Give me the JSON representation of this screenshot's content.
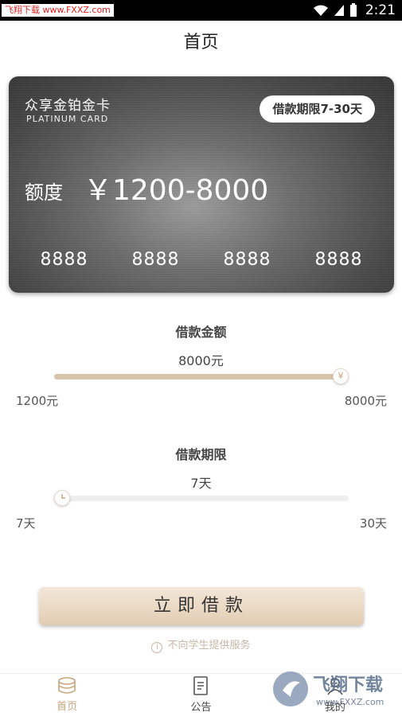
{
  "status_bar": {
    "watermark": "飞翔下载 www.FXXZ.com",
    "time": "2:21"
  },
  "header": {
    "title": "首页"
  },
  "card": {
    "name": "众享金铂金卡",
    "sub_name": "PLATINUM CARD",
    "term_badge": "借款期限7-30天",
    "amount_label": "额度",
    "amount_range": "￥1200-8000",
    "numbers": [
      "8888",
      "8888",
      "8888",
      "8888"
    ]
  },
  "loan_amount": {
    "label": "借款金额",
    "value_text": "8000元",
    "min_label": "1200元",
    "max_label": "8000元",
    "fill_fraction": 1.0
  },
  "loan_term": {
    "label": "借款期限",
    "value_text": "7天",
    "min_label": "7天",
    "max_label": "30天",
    "fill_fraction": 0.0
  },
  "borrow_button": {
    "label": "立即借款"
  },
  "notice": {
    "text": "不向学生提供服务"
  },
  "tabs": [
    {
      "label": "首页",
      "icon": "coins-icon",
      "active": true
    },
    {
      "label": "公告",
      "icon": "document-icon",
      "active": false
    },
    {
      "label": "我的",
      "icon": "user-icon",
      "active": false
    }
  ],
  "watermark_bottom": {
    "text": "飞翔下载",
    "url": "www.FXXZ.com"
  },
  "colors": {
    "accent": "#c8a47c",
    "slider_fill": "#d8c4ab",
    "button_bg": "#e8d6c0"
  }
}
